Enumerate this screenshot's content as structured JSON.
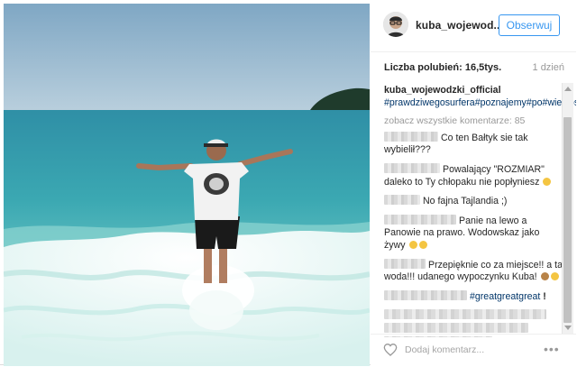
{
  "header": {
    "username": "kuba_wojewod...",
    "follow_label": "Obserwuj"
  },
  "stats": {
    "likes": "Liczba polubień: 16,5tys.",
    "time": "1 dzień"
  },
  "caption": {
    "user": "kuba_wojewodzki_official",
    "hashtags": "#prawdziwegosurfera#poznajemy#po#wielkosci#jego#fali"
  },
  "view_all": "zobacz wszystkie komentarze: 85",
  "comments": [
    {
      "text": "Co ten Bałtyk sie tak wybielił???"
    },
    {
      "text": "Powalający \"ROZMIAR\" daleko to Ty chłopaku nie popłyniesz"
    },
    {
      "text": "No fajna Tajlandia ;)"
    },
    {
      "text": "Panie na lewo a Panowie na prawo. Wodowskaz jako żywy"
    },
    {
      "text": "Przepięknie co za miejsce!! a ta woda!!! udanego wypoczynku Kuba!"
    },
    {
      "text": "#greatgreatgreat"
    }
  ],
  "footer": {
    "comment_placeholder": "Dodaj komentarz...",
    "more_label": "•••"
  },
  "icons": {
    "heart": "heart-icon",
    "more": "more-options-icon",
    "avatar": "avatar"
  },
  "colors": {
    "link": "#003569",
    "button": "#3897f0",
    "muted": "#999999"
  }
}
